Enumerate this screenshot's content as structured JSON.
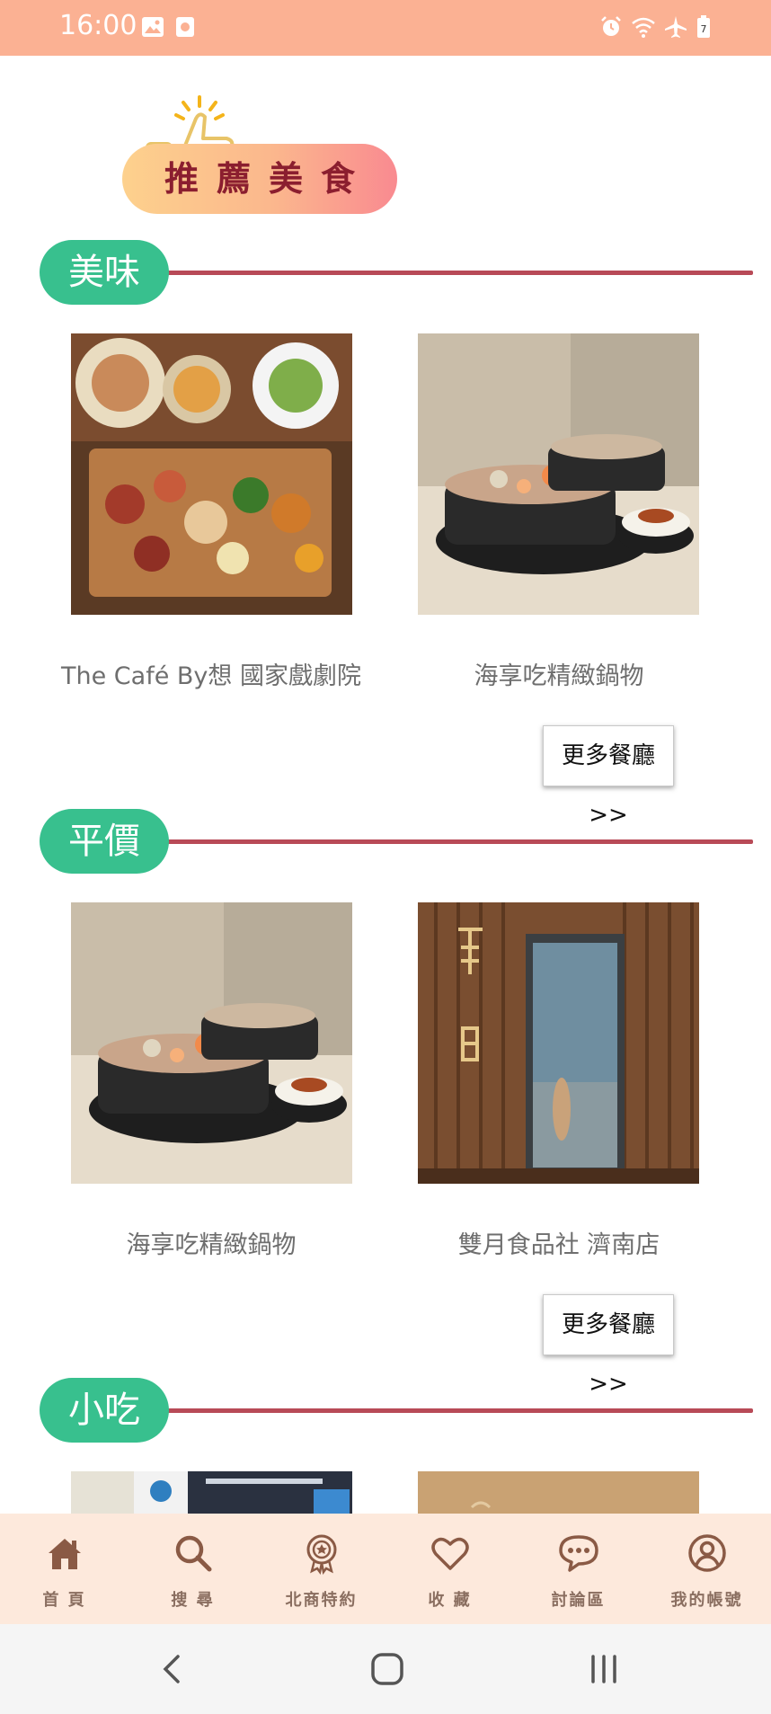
{
  "status_bar": {
    "time": "16:00",
    "left_icons": [
      "image-icon",
      "app-notification-icon"
    ],
    "right_icons": [
      "alarm-icon",
      "wifi-icon",
      "airplane-mode-icon",
      "battery-icon"
    ],
    "battery_level": "7",
    "background_color": "#fbb193"
  },
  "hero": {
    "title": "推薦美食",
    "icon": "thumbs-up-icon"
  },
  "sections": [
    {
      "label": "美味",
      "cards": [
        {
          "title": "The Café By想 國家戲劇院"
        },
        {
          "title": "海享吃精緻鍋物"
        }
      ],
      "more_label": "更多餐廳>>"
    },
    {
      "label": "平價",
      "cards": [
        {
          "title": "海享吃精緻鍋物"
        },
        {
          "title": "雙月食品社 濟南店"
        }
      ],
      "more_label": "更多餐廳>>"
    },
    {
      "label": "小吃"
    }
  ],
  "bottom_nav": [
    {
      "label": "首 頁",
      "icon": "home-icon"
    },
    {
      "label": "搜 尋",
      "icon": "search-icon"
    },
    {
      "label": "北商特約",
      "icon": "badge-icon"
    },
    {
      "label": "收 藏",
      "icon": "heart-icon"
    },
    {
      "label": "討論區",
      "icon": "chat-icon"
    },
    {
      "label": "我的帳號",
      "icon": "account-icon"
    }
  ],
  "system_nav": [
    "back-icon",
    "home-circle-icon",
    "recents-icon"
  ],
  "colors": {
    "accent_green": "#38c08e",
    "divider_red": "#b84a57",
    "nav_background": "#fde9dc",
    "nav_text": "#8a6e60"
  }
}
